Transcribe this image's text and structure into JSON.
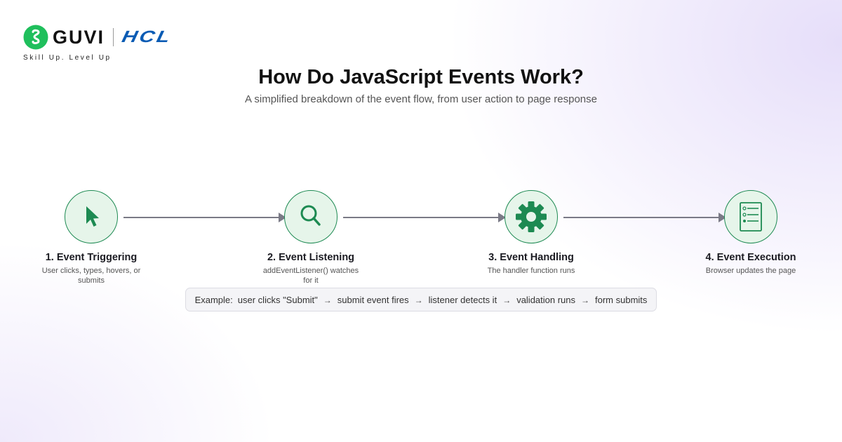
{
  "brand": {
    "guvi_text": "GUVI",
    "hcl_text": "HCL",
    "tagline": "Skill Up. Level Up",
    "guvi_color": "#1fbf5c",
    "hcl_color": "#0a5bb4"
  },
  "header": {
    "title": "How Do JavaScript Events Work?",
    "subtitle": "A simplified breakdown of the event flow, from user action to page response"
  },
  "steps": [
    {
      "title": "1. Event Triggering",
      "description": "User clicks, types, hovers, or submits",
      "icon": "cursor-icon"
    },
    {
      "title": "2. Event Listening",
      "description": "addEventListener() watches for it",
      "icon": "search-icon"
    },
    {
      "title": "3. Event Handling",
      "description": "The handler function runs",
      "icon": "gear-icon"
    },
    {
      "title": "4. Event Execution",
      "description": "Browser updates the page",
      "icon": "checklist-icon"
    }
  ],
  "example": {
    "label": "Example:",
    "flow": [
      "user clicks \"Submit\"",
      "submit event fires",
      "listener detects it",
      "validation runs",
      "form submits"
    ],
    "arrow": "→"
  },
  "colors": {
    "accent_green": "#1d8a52",
    "circle_fill": "#e6f5ea",
    "connector": "#7a7a86"
  }
}
